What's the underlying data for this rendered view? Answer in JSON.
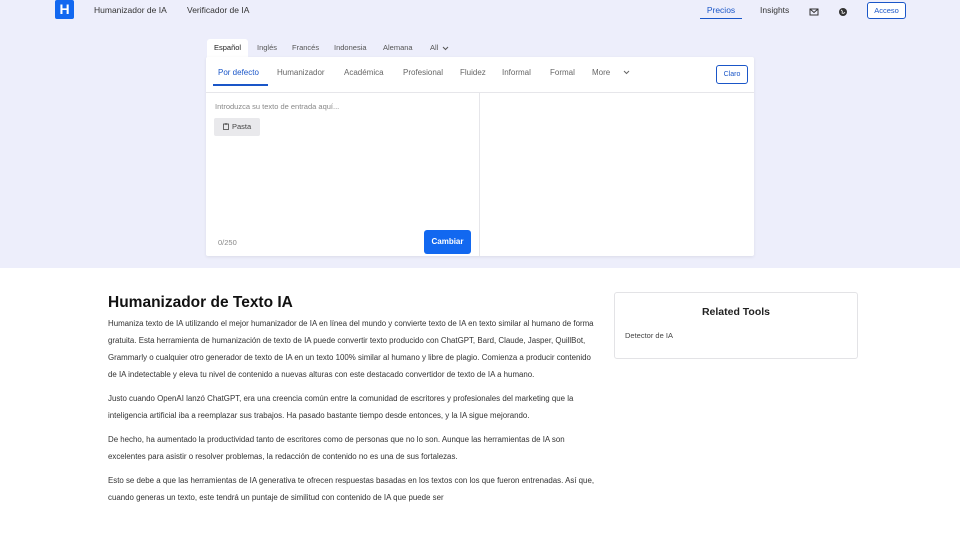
{
  "nav": {
    "logo_letter": "H",
    "links": [
      "Humanizador de IA",
      "Verificador de IA"
    ],
    "pricing": "Precios",
    "insights": "Insights",
    "access": "Acceso",
    "icons": [
      "mail-icon",
      "globe-icon"
    ]
  },
  "languages": {
    "tabs": [
      "Español",
      "Inglés",
      "Francés",
      "Indonesia",
      "Alemana",
      "All"
    ],
    "active": "Español"
  },
  "tool": {
    "modes": [
      "Por defecto",
      "Humanizador",
      "Académica",
      "Profesional",
      "Fluidez",
      "Informal",
      "Formal",
      "More"
    ],
    "active_mode": "Por defecto",
    "clear_label": "Claro",
    "input_placeholder": "Introduzca su texto de entrada aquí...",
    "paste_label": "Pasta",
    "counter": "0/250",
    "submit_label": "Cambiar"
  },
  "article": {
    "title": "Humanizador de Texto IA",
    "paragraphs": [
      "Humaniza texto de IA utilizando el mejor humanizador de IA en línea del mundo y convierte texto de IA en texto similar al humano de forma gratuita. Esta herramienta de humanización de texto de IA puede convertir texto producido con ChatGPT, Bard, Claude, Jasper, QuillBot, Grammarly o cualquier otro generador de texto de IA en un texto 100% similar al humano y libre de plagio. Comienza a producir contenido de IA indetectable y eleva tu nivel de contenido a nuevas alturas con este destacado convertidor de texto de IA a humano.",
      "Justo cuando OpenAI lanzó ChatGPT, era una creencia común entre la comunidad de escritores y profesionales del marketing que la inteligencia artificial iba a reemplazar sus trabajos. Ha pasado bastante tiempo desde entonces, y la IA sigue mejorando.",
      "De hecho, ha aumentado la productividad tanto de escritores como de personas que no lo son. Aunque las herramientas de IA son excelentes para asistir o resolver problemas, la redacción de contenido no es una de sus fortalezas.",
      "Esto se debe a que las herramientas de IA generativa te ofrecen respuestas basadas en los textos con los que fueron entrenadas. Así que, cuando generas un texto, este tendrá un puntaje de similitud con contenido de IA que puede ser"
    ]
  },
  "related": {
    "title": "Related Tools",
    "items": [
      "Detector de IA"
    ]
  },
  "colors": {
    "accent": "#1268f0",
    "hero_bg": "#edeefb"
  }
}
